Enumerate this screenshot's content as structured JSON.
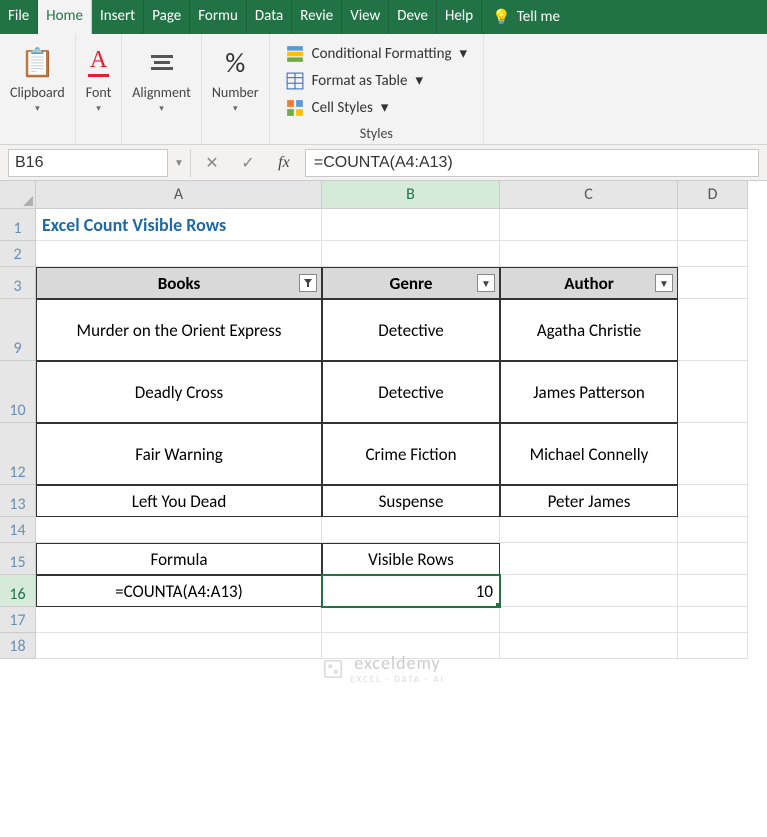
{
  "tabs": [
    "File",
    "Home",
    "Insert",
    "Page",
    "Formu",
    "Data",
    "Revie",
    "View",
    "Deve",
    "Help"
  ],
  "tellme": "Tell me",
  "ribbon": {
    "clipboard": "Clipboard",
    "font": "Font",
    "alignment": "Alignment",
    "number": "Number",
    "styles_caption": "Styles",
    "cond_fmt": "Conditional Formatting",
    "fmt_table": "Format as Table",
    "cell_styles": "Cell Styles"
  },
  "namebox": "B16",
  "formula": "=COUNTA(A4:A13)",
  "columns": [
    "A",
    "B",
    "C",
    "D"
  ],
  "row_numbers": [
    "1",
    "2",
    "3",
    "9",
    "10",
    "12",
    "13",
    "14",
    "15",
    "16",
    "17",
    "18"
  ],
  "title": "Excel Count Visible Rows",
  "headers": {
    "a": "Books",
    "b": "Genre",
    "c": "Author"
  },
  "data": [
    {
      "a": "Murder on the Orient Express",
      "b": "Detective",
      "c": "Agatha Christie"
    },
    {
      "a": "Deadly Cross",
      "b": "Detective",
      "c": "James Patterson"
    },
    {
      "a": "Fair Warning",
      "b": "Crime Fiction",
      "c": "Michael Connelly"
    },
    {
      "a": "Left You Dead",
      "b": "Suspense",
      "c": "Peter James"
    }
  ],
  "formula_row": {
    "label_a": "Formula",
    "label_b": "Visible Rows",
    "value_a": "=COUNTA(A4:A13)",
    "value_b": "10"
  },
  "watermark": {
    "main": "exceldemy",
    "sub": "EXCEL · DATA · AI"
  },
  "percent_glyph": "%"
}
